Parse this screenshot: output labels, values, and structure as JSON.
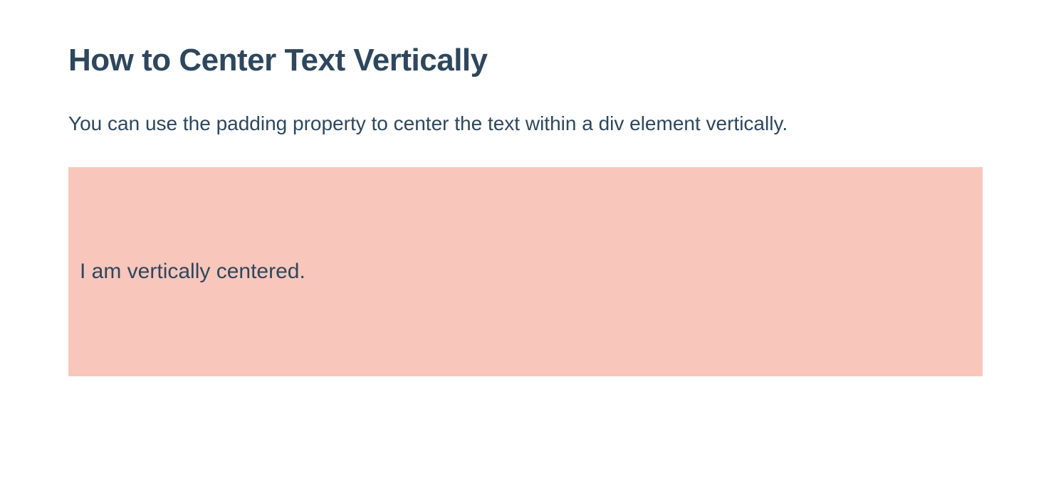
{
  "heading": "How to Center Text Vertically",
  "description": "You can use the padding property to center the text within a div element vertically.",
  "demo": {
    "text": "I am vertically centered."
  },
  "colors": {
    "text": "#2e475d",
    "demo_bg": "#f9c6bb"
  }
}
